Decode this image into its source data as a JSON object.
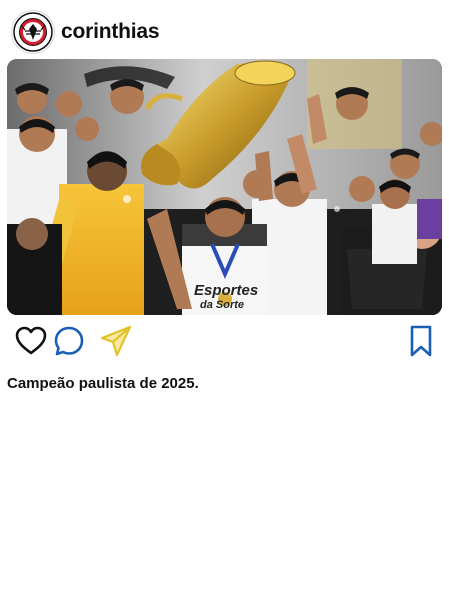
{
  "post": {
    "username": "corinthias",
    "caption": "Campeão paulista de 2025.",
    "photo_text": {
      "sponsor_line1": "Esportes",
      "sponsor_line2": "da Sorte"
    }
  },
  "icons": {
    "avatar": "corinthians-crest-icon",
    "like": "heart-icon",
    "comment": "comment-bubble-icon",
    "share": "paper-plane-icon",
    "save": "bookmark-icon"
  },
  "colors": {
    "comment_icon": "#1a5fb4",
    "share_icon": "#f2d73a",
    "save_icon": "#1a5fb4",
    "text": "#111111",
    "crest_red": "#d21f2d"
  }
}
